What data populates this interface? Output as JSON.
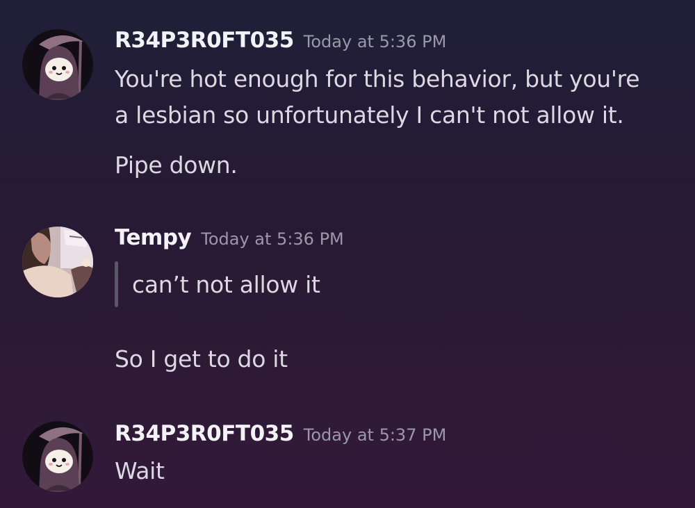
{
  "messages": [
    {
      "author": "R34P3R0FT035",
      "timestamp": "Today at 5:36 PM",
      "avatar_icon": "reaper-avatar-icon",
      "lines": [
        "You're hot enough for this behavior, but you're",
        "a lesbian so unfortunately I can't not allow it.",
        "Pipe down."
      ]
    },
    {
      "author": "Tempy",
      "timestamp": "Today at 5:36 PM",
      "avatar_icon": "photo-avatar",
      "quote": "can’t not allow it",
      "lines": [
        "So I get to do it"
      ]
    },
    {
      "author": "R34P3R0FT035",
      "timestamp": "Today at 5:37 PM",
      "avatar_icon": "reaper-avatar-icon",
      "lines": [
        "Wait"
      ]
    }
  ],
  "colors": {
    "background_top": "#201f38",
    "background_bottom": "#32193a",
    "username": "#f3f2f6",
    "timestamp": "#9b98a8",
    "message_text": "#dcd9e2",
    "quote_bar": "#5a5868"
  }
}
